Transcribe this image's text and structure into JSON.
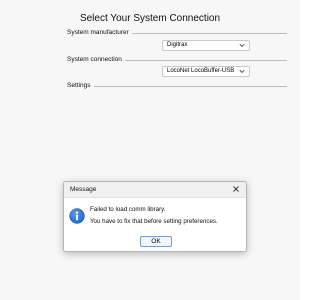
{
  "window": {
    "heading": "Select Your System Connection"
  },
  "groups": {
    "manufacturer_label": "System manufacturer",
    "connection_label": "System connection",
    "settings_label": "Settings"
  },
  "fields": {
    "manufacturer_value": "Digitrax",
    "connection_value": "LocoNet LocoBuffer-USB"
  },
  "dialog": {
    "title": "Message",
    "line1": "Failed to load comm library.",
    "line2": "You have to fix that before setting preferences.",
    "ok_label": "OK"
  },
  "colors": {
    "info_icon": "#1f63c6",
    "button_border": "#7a9bd2"
  },
  "icons": {
    "close": "close-icon",
    "info": "info-icon",
    "dropdown": "chevron-down-icon"
  }
}
